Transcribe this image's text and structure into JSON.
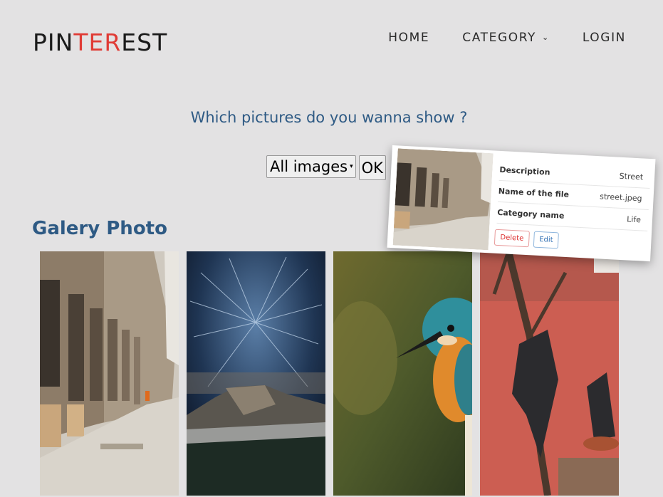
{
  "logo": {
    "part1": "PIN",
    "accent": "TER",
    "part2": "EST"
  },
  "nav": {
    "home": "HOME",
    "category": "CATEGORY",
    "login": "LOGIN"
  },
  "filter": {
    "question": "Which pictures do you wanna show ?",
    "selected": "All images",
    "ok_label": "OK"
  },
  "gallery": {
    "title": "Galery Photo",
    "photos": [
      "street",
      "starry-mountain",
      "kingfisher",
      "bat-plant"
    ]
  },
  "detail": {
    "rows": [
      {
        "key": "Description",
        "value": "Street"
      },
      {
        "key": "Name of the file",
        "value": "street.jpeg"
      },
      {
        "key": "Category name",
        "value": "Life"
      }
    ],
    "delete_label": "Delete",
    "edit_label": "Edit"
  },
  "colors": {
    "accent_red": "#e03b35",
    "title_blue": "#2e5a84",
    "background": "#e3e2e3"
  }
}
